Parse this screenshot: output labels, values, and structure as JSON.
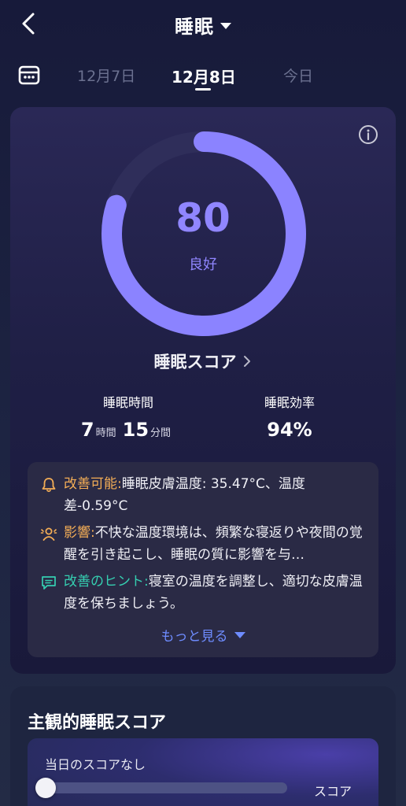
{
  "header": {
    "title": "睡眠"
  },
  "date_tabs": [
    {
      "label": "12月7日",
      "active": false
    },
    {
      "label": "12月8日",
      "active": true
    },
    {
      "label": "今日",
      "active": false
    }
  ],
  "score_card": {
    "score": "80",
    "grade": "良好",
    "score_fraction": 0.8,
    "ring_color": "#8b83ff",
    "link_label": "睡眠スコア",
    "duration": {
      "label": "睡眠時間",
      "hours": "7",
      "hours_unit": "時間",
      "minutes": "15",
      "minutes_unit": "分間"
    },
    "efficiency": {
      "label": "睡眠効率",
      "value": "94%"
    }
  },
  "insights": {
    "improve": {
      "label": "改善可能:",
      "text": "睡眠皮膚温度: 35.47°C、温度差-0.59°C"
    },
    "impact": {
      "label": "影響:",
      "text": "不快な温度環境は、頻繁な寝返りや夜間の覚醒を引き起こし、睡眠の質に影響を与…"
    },
    "hint": {
      "label": "改善のヒント:",
      "text": "寝室の温度を調整し、適切な皮膚温度を保ちましょう。"
    },
    "icons": {
      "improve": "bell-icon",
      "impact": "person-alert-icon",
      "hint": "tips-icon"
    },
    "more": "もっと見る"
  },
  "subjective": {
    "title": "主観的睡眠スコア",
    "no_score": "当日のスコアなし",
    "score_word": "スコア",
    "slider_value": 0
  },
  "colors": {
    "accent": "#9086ff",
    "orange": "#f3ad56",
    "teal": "#35cfb1",
    "link": "#6e8cff"
  }
}
